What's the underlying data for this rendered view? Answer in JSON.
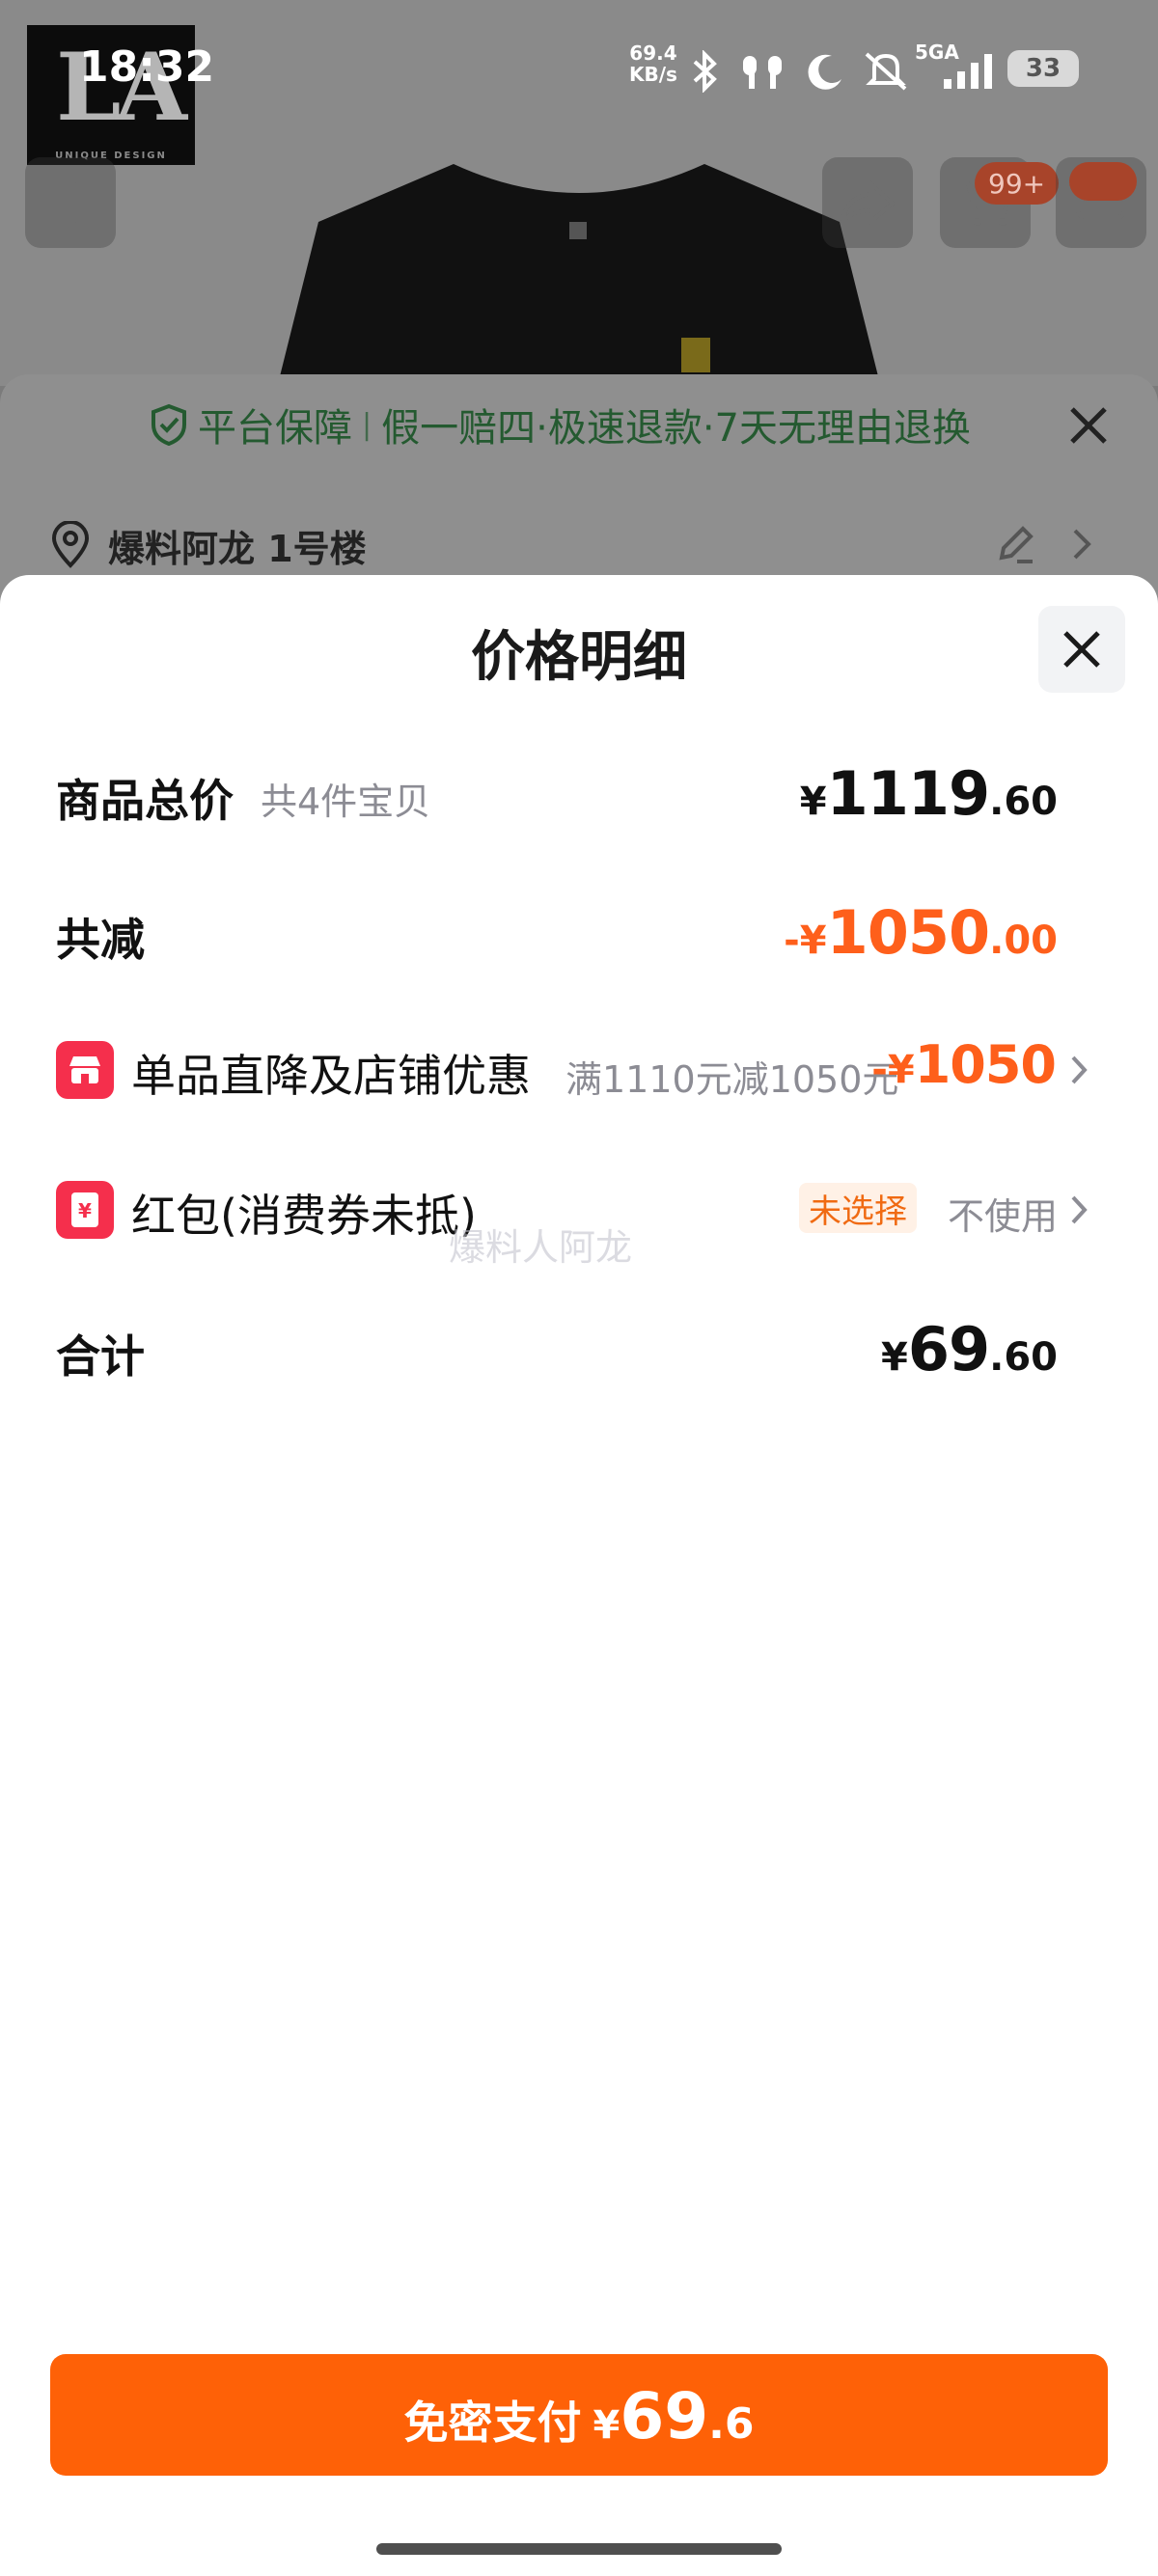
{
  "status_bar": {
    "time": "18:32",
    "net_speed_value": "69.4",
    "net_speed_unit": "KB/s",
    "network": "5GA",
    "battery": "33",
    "icons": [
      "bluetooth-icon",
      "earbuds-icon",
      "moon-icon",
      "mute-icon",
      "signal-icon"
    ]
  },
  "logo": {
    "text": "LA",
    "subtext": "UNIQUE DESIGN"
  },
  "nav": {
    "cart_badge": "99+"
  },
  "guarantee": {
    "label": "平台保障",
    "separator": "|",
    "items": "假一赔四·极速退款·7天无理由退换"
  },
  "address": {
    "text": "爆料阿龙 1号楼"
  },
  "sheet": {
    "title": "价格明细",
    "total_label": "商品总价",
    "total_count": "共4件宝贝",
    "total_currency": "¥",
    "total_int": "1119",
    "total_dec": ".60",
    "discount_label": "共减",
    "discount_prefix": "-¥",
    "discount_int": "1050",
    "discount_dec": ".00",
    "store_label": "单品直降及店铺优惠",
    "store_desc": "满1110元减1050元",
    "store_amount_prefix": "-¥",
    "store_amount_int": "1050",
    "redpacket_label": "红包(消费券未抵)",
    "redpacket_tag": "未选择",
    "redpacket_status": "不使用",
    "sum_label": "合计",
    "sum_currency": "¥",
    "sum_int": "69",
    "sum_dec": ".60",
    "watermark": "爆料人阿龙"
  },
  "pay_button": {
    "label": "免密支付",
    "currency": "¥",
    "int": "69",
    "dec": ".6"
  },
  "colors": {
    "accent_orange": "#fe6107",
    "discount_text": "#fe5f1b",
    "coupon_red": "#f52f4c",
    "guarantee_green": "#245a30"
  }
}
